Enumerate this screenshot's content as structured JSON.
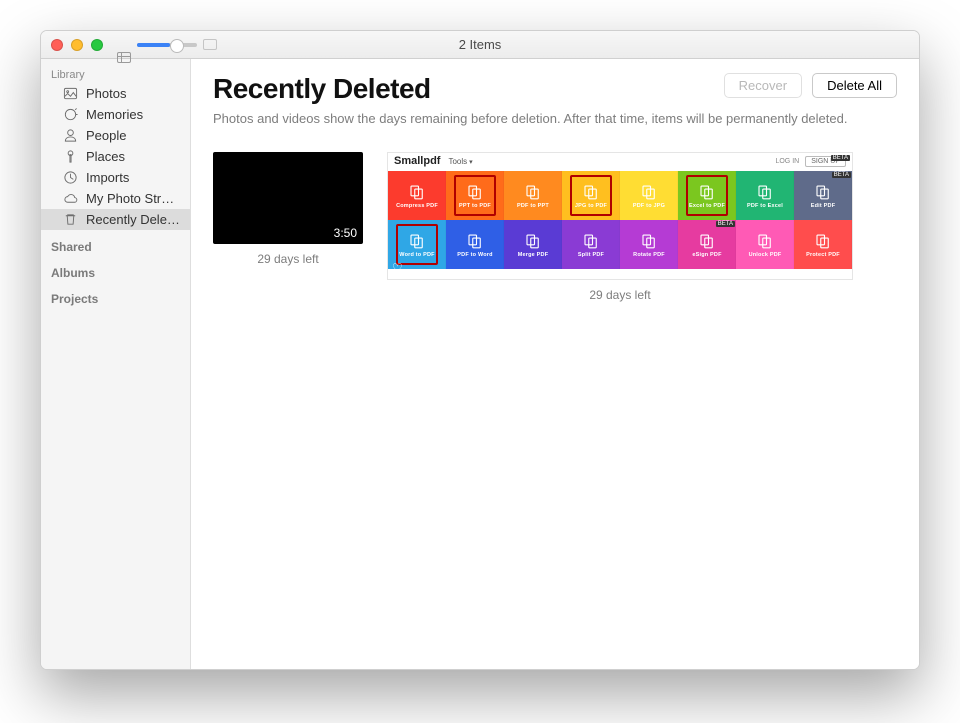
{
  "titlebar": {
    "title": "2 Items"
  },
  "sidebar": {
    "header1": "Library",
    "items": [
      {
        "label": "Photos",
        "icon": "photos"
      },
      {
        "label": "Memories",
        "icon": "memories"
      },
      {
        "label": "People",
        "icon": "people"
      },
      {
        "label": "Places",
        "icon": "places"
      },
      {
        "label": "Imports",
        "icon": "imports"
      },
      {
        "label": "My Photo Str…",
        "icon": "cloud"
      },
      {
        "label": "Recently Dele…",
        "icon": "trash",
        "selected": true
      }
    ],
    "section_shared": "Shared",
    "section_albums": "Albums",
    "section_projects": "Projects"
  },
  "main": {
    "title": "Recently Deleted",
    "recover_label": "Recover",
    "delete_all_label": "Delete All",
    "description": "Photos and videos show the days remaining before deletion. After that time, items will be permanently deleted."
  },
  "items": [
    {
      "kind": "video",
      "duration": "3:50",
      "caption": "29 days left"
    },
    {
      "kind": "screenshot",
      "caption": "29 days left"
    }
  ],
  "screenshot": {
    "logo": "Smallpdf",
    "tools_label": "Tools",
    "login_label": "LOG IN",
    "signup_label": "SIGN UP",
    "beta_label": "BETA",
    "row1": [
      {
        "label": "Compress PDF",
        "color": "#fc3b2d"
      },
      {
        "label": "PPT to PDF",
        "color": "#ff6b1a",
        "boxed": true
      },
      {
        "label": "PDF to PPT",
        "color": "#ff8a1f"
      },
      {
        "label": "JPG to PDF",
        "color": "#ffbf1f",
        "boxed": true
      },
      {
        "label": "PDF to JPG",
        "color": "#ffdd33"
      },
      {
        "label": "Excel to PDF",
        "color": "#7bc71f",
        "boxed": true
      },
      {
        "label": "PDF to Excel",
        "color": "#21b573"
      },
      {
        "label": "Edit PDF",
        "color": "#5f6b8a",
        "beta_top": true
      }
    ],
    "row2": [
      {
        "label": "Word to PDF",
        "color": "#2fa7e6",
        "boxed": true
      },
      {
        "label": "PDF to Word",
        "color": "#2f5fe6"
      },
      {
        "label": "Merge PDF",
        "color": "#5a3bd4"
      },
      {
        "label": "Split PDF",
        "color": "#8a3bd4"
      },
      {
        "label": "Rotate PDF",
        "color": "#b53bd4"
      },
      {
        "label": "eSign PDF",
        "color": "#e63ba0",
        "beta_top": true
      },
      {
        "label": "Unlock PDF",
        "color": "#ff5ab5"
      },
      {
        "label": "Protect PDF",
        "color": "#ff4d4d"
      }
    ]
  }
}
